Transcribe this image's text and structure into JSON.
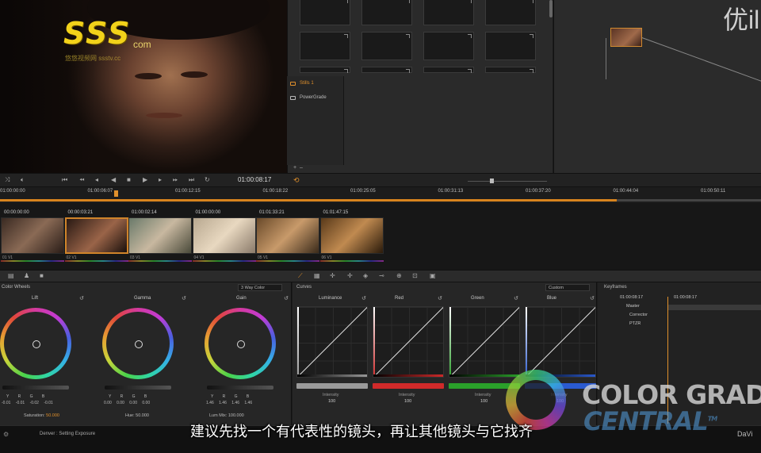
{
  "watermark": {
    "logo": "SSS",
    "logo_suffix": "com",
    "logo_sub": "悠悠视频网 ssstv.cc",
    "top_right_text": "优il"
  },
  "gallery": {
    "albums": [
      {
        "label": "Stills 1",
        "selected": true
      },
      {
        "label": "PowerGrade",
        "selected": false
      }
    ]
  },
  "transport": {
    "timecode": "01:00:08:17"
  },
  "ruler": {
    "ticks": [
      "01:00:00:00",
      "01:00:06:07",
      "01:00:12:15",
      "01:00:18:22",
      "01:00:25:05",
      "01:00:31:13",
      "01:00:37:20",
      "01:00:44:04",
      "01:00:50:11"
    ],
    "playhead_fraction": 0.81
  },
  "clips": [
    {
      "tc": "00:00:00:00",
      "label": "01 V1",
      "selected": false
    },
    {
      "tc": "00:00:03:21",
      "label": "02 V1",
      "selected": true
    },
    {
      "tc": "01:00:02:14",
      "label": "03 V1",
      "selected": false
    },
    {
      "tc": "01:00:00:00",
      "label": "04 V1",
      "selected": false
    },
    {
      "tc": "01:01:33:21",
      "label": "05 V1",
      "selected": false
    },
    {
      "tc": "01:01:47:15",
      "label": "06 V1",
      "selected": false
    }
  ],
  "wheels_panel": {
    "title": "Color Wheels",
    "mode": "3 Way Color",
    "wheels": [
      {
        "name": "Lift",
        "rgb_labels": "Y R G B",
        "values": "-0.01 -0.01 -0.02 -0.01"
      },
      {
        "name": "Gamma",
        "rgb_labels": "Y R G B",
        "values": "0.00 0.00 0.00 0.00"
      },
      {
        "name": "Gain",
        "rgb_labels": "Y R G B",
        "values": "1.46 1.46 1.46 1.46"
      }
    ],
    "saturation_label": "Saturation:",
    "saturation_value": "50.000",
    "hue_label": "Hue:",
    "hue_value": "50.000",
    "lum_mix_label": "Lum Mix:",
    "lum_mix_value": "100.000"
  },
  "curves_panel": {
    "title": "Curves",
    "mode": "Custom",
    "curves": [
      {
        "name": "Luminance",
        "intensity_label": "Intensity",
        "intensity": "100",
        "color": "#9a9a9a"
      },
      {
        "name": "Red",
        "intensity_label": "Intensity",
        "intensity": "100",
        "color": "#d02a2a"
      },
      {
        "name": "Green",
        "intensity_label": "Intensity",
        "intensity": "100",
        "color": "#2aa02a"
      },
      {
        "name": "Blue",
        "intensity_label": "Intensity",
        "intensity": "100",
        "color": "#2a5ad0"
      }
    ]
  },
  "keyframes_panel": {
    "title": "Keyframes",
    "timecode_left": "01:00:08:17",
    "timecode_right": "01:00:08:17",
    "rows": [
      "Master",
      "Corrector",
      "PTZR"
    ]
  },
  "status": {
    "left_text": "Denver : Setting Exposure",
    "right_text": "DaVi"
  },
  "subtitle": "建议先找一个有代表性的镜头，再让其他镜头与它找齐",
  "brand": {
    "line1": "COLOR GRADE",
    "line2": "CENTRAL",
    "trademark": "TM"
  },
  "colors": {
    "accent": "#e0902c",
    "background": "#1b1b1b"
  }
}
